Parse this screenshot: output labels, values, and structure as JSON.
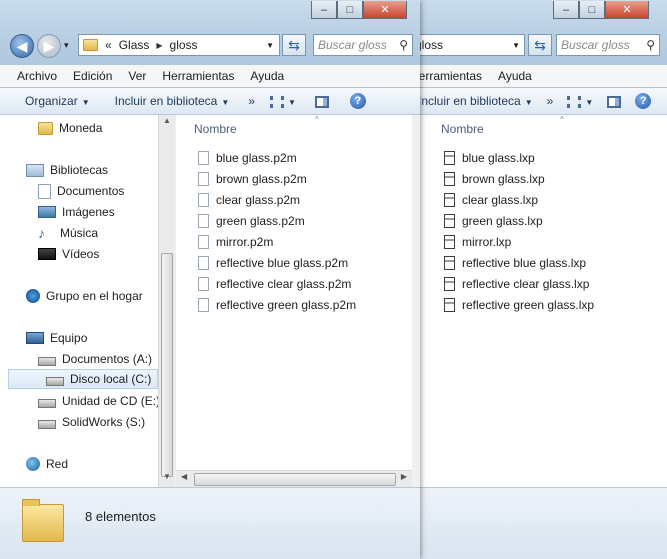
{
  "back_window": {
    "caption_buttons": {
      "minimize": "–",
      "maximize": "□",
      "close": "✕"
    },
    "address": {
      "path": [
        "gloss"
      ]
    },
    "search_placeholder": "Buscar gloss",
    "menu": [
      "Herramientas",
      "Ayuda"
    ],
    "toolbar": {
      "include_label": "Incluir en biblioteca",
      "more": "»"
    },
    "column_header": "Nombre",
    "files": [
      "blue glass.lxp",
      "brown glass.lxp",
      "clear glass.lxp",
      "green glass.lxp",
      "mirror.lxp",
      "reflective blue glass.lxp",
      "reflective clear glass.lxp",
      "reflective green glass.lxp"
    ]
  },
  "front_window": {
    "caption_buttons": {
      "minimize": "–",
      "maximize": "□",
      "close": "✕"
    },
    "nav": {
      "back": "◀",
      "forward": "▶",
      "history": "▾"
    },
    "address": {
      "overflow": "«",
      "path": [
        "Glass",
        "gloss"
      ]
    },
    "search_placeholder": "Buscar gloss",
    "menu": [
      "Archivo",
      "Edición",
      "Ver",
      "Herramientas",
      "Ayuda"
    ],
    "toolbar": {
      "organize_label": "Organizar",
      "include_label": "Incluir en biblioteca",
      "more": "»"
    },
    "nav_pane": [
      {
        "label": "Moneda",
        "icon": "folder-icon"
      },
      {
        "label": "Bibliotecas",
        "icon": "libraries-icon"
      },
      {
        "label": "Documentos",
        "icon": "documents-icon"
      },
      {
        "label": "Imágenes",
        "icon": "pictures-icon"
      },
      {
        "label": "Música",
        "icon": "music-icon"
      },
      {
        "label": "Vídeos",
        "icon": "videos-icon"
      },
      {
        "label": "Grupo en el hogar",
        "icon": "homegroup-icon"
      },
      {
        "label": "Equipo",
        "icon": "computer-icon"
      },
      {
        "label": "Documentos (A:)",
        "icon": "drive-icon"
      },
      {
        "label": "Disco local (C:)",
        "icon": "drive-icon",
        "selected": true
      },
      {
        "label": "Unidad de CD (E:)",
        "icon": "cd-drive-icon"
      },
      {
        "label": "SolidWorks (S:)",
        "icon": "drive-icon"
      },
      {
        "label": "Red",
        "icon": "network-icon"
      }
    ],
    "column_header": "Nombre",
    "files": [
      "blue glass.p2m",
      "brown glass.p2m",
      "clear glass.p2m",
      "green glass.p2m",
      "mirror.p2m",
      "reflective blue glass.p2m",
      "reflective clear glass.p2m",
      "reflective green glass.p2m"
    ],
    "status": {
      "item_count": "8 elementos"
    }
  }
}
